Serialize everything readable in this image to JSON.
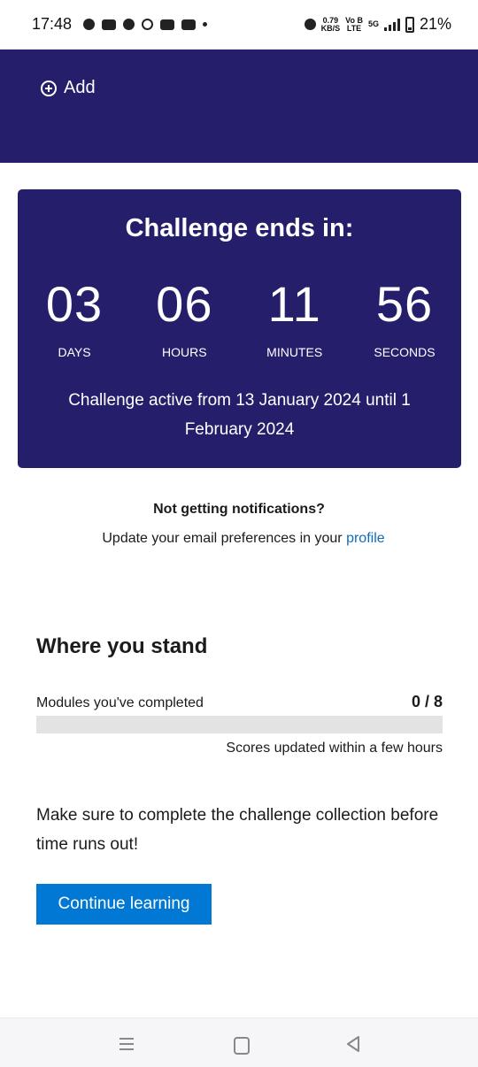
{
  "status_bar": {
    "time": "17:48",
    "speed_value": "0.79",
    "speed_unit": "KB/S",
    "net_type_a": "Vo B",
    "net_type_b": "LTE",
    "net_5g": "5G",
    "battery": "21%"
  },
  "header": {
    "add_label": "Add"
  },
  "countdown": {
    "title": "Challenge ends in:",
    "units": [
      {
        "value": "03",
        "label": "DAYS"
      },
      {
        "value": "06",
        "label": "HOURS"
      },
      {
        "value": "11",
        "label": "MINUTES"
      },
      {
        "value": "56",
        "label": "SECONDS"
      }
    ],
    "period_text": "Challenge active from 13 January 2024 until 1 February 2024"
  },
  "notifications": {
    "title": "Not getting notifications?",
    "text": "Update your email preferences in your ",
    "link": "profile"
  },
  "standing": {
    "heading": "Where you stand",
    "modules_label": "Modules you've completed",
    "modules_count": "0 / 8",
    "progress_fraction": 0,
    "scores_note": "Scores updated within a few hours"
  },
  "encouragement": "Make sure to complete the challenge collection before time runs out!",
  "continue_button": "Continue learning",
  "colors": {
    "brand_navy": "#251f6b",
    "accent_blue": "#0078d4",
    "link_blue": "#0f6cbd"
  }
}
